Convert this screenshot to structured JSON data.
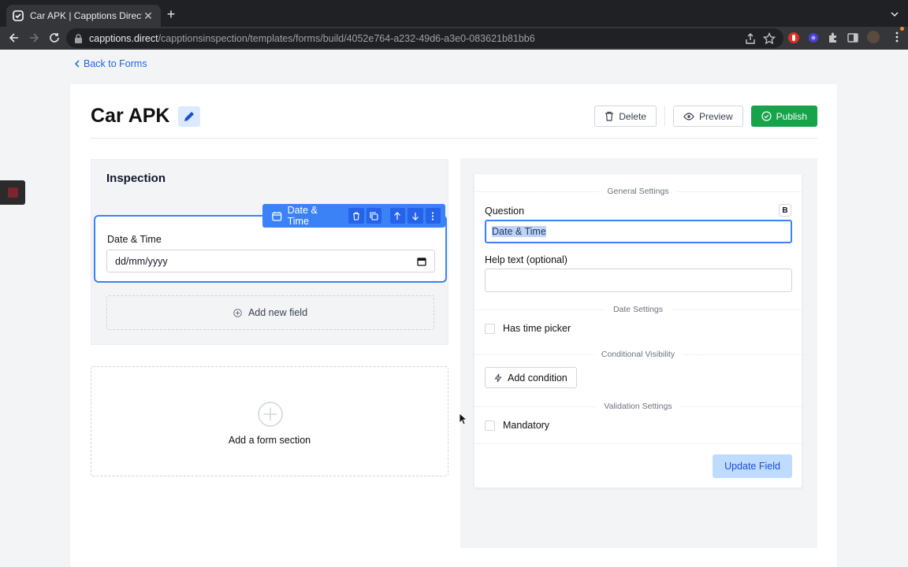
{
  "browser": {
    "tab_title": "Car APK | Capptions Direct",
    "url_host": "capptions.direct",
    "url_path": "/capptionsinspection/templates/forms/build/4052e764-a232-49d6-a3e0-083621b81bb6"
  },
  "page": {
    "back_link": "Back to Forms",
    "form_title": "Car APK",
    "actions": {
      "delete": "Delete",
      "preview": "Preview",
      "publish": "Publish"
    }
  },
  "section": {
    "title": "Inspection",
    "field": {
      "type_label": "Date & Time",
      "label": "Date & Time",
      "placeholder": "dd/mm/yyyy"
    },
    "add_field": "Add new field",
    "add_section": "Add a form section"
  },
  "settings": {
    "general_heading": "General Settings",
    "question_label": "Question",
    "bold_toggle": "B",
    "question_value": "Date & Time",
    "help_label": "Help text (optional)",
    "help_value": "",
    "date_heading": "Date Settings",
    "time_picker": "Has time picker",
    "time_picker_checked": false,
    "conditional_heading": "Conditional Visibility",
    "add_condition": "Add condition",
    "validation_heading": "Validation Settings",
    "mandatory": "Mandatory",
    "mandatory_checked": false,
    "update_button": "Update Field"
  },
  "colors": {
    "accent": "#3b82f6",
    "publish": "#16a34a",
    "link": "#2563eb"
  }
}
